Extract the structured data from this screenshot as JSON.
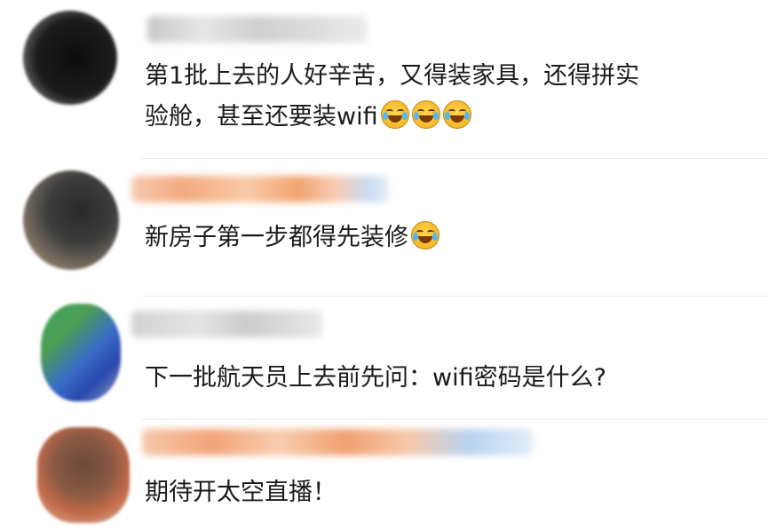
{
  "comments": [
    {
      "text": "第1批上去的人好辛苦，又得装家具，还得拼实",
      "text_line2": "验舱，甚至还要装wifi",
      "emojis": [
        "crying-laughing-emoji",
        "crying-laughing-emoji",
        "crying-laughing-emoji"
      ]
    },
    {
      "text": "新房子第一步都得先装修",
      "emojis": [
        "crying-laughing-emoji"
      ]
    },
    {
      "text": "下一批航天员上去前先问：wifi密码是什么?"
    },
    {
      "text": "期待开太空直播！"
    }
  ]
}
